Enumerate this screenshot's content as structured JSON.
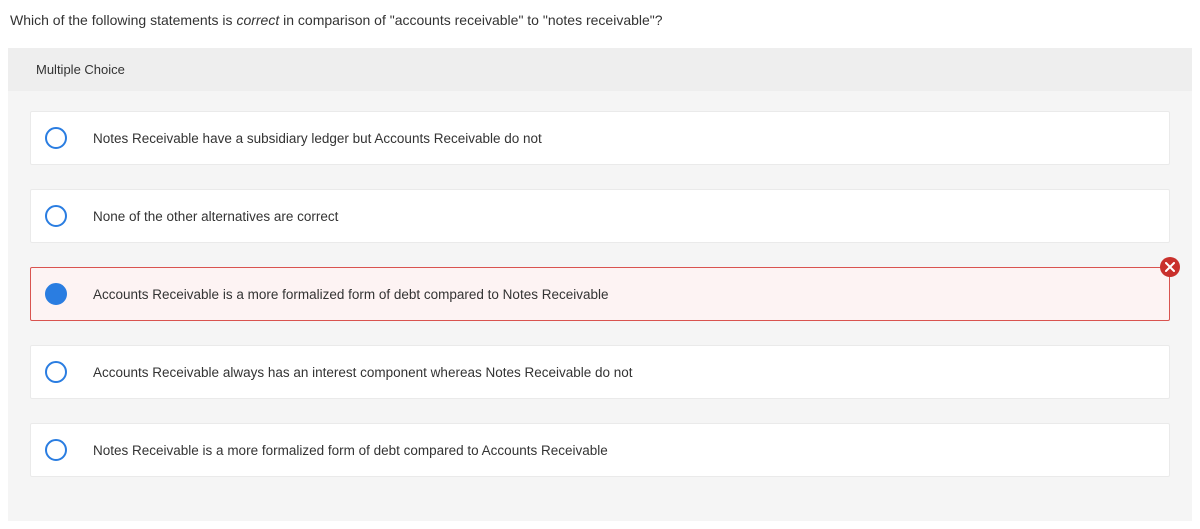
{
  "question": {
    "prefix": "Which of the following statements is ",
    "italic": "correct",
    "suffix": " in comparison of \"accounts receivable\" to \"notes receivable\"?"
  },
  "panel_label": "Multiple Choice",
  "options": [
    {
      "text": "Notes Receivable have a subsidiary ledger but Accounts Receivable do not",
      "selected": false,
      "wrong": false
    },
    {
      "text": "None of the other alternatives are correct",
      "selected": false,
      "wrong": false
    },
    {
      "text": "Accounts Receivable is a more formalized form of debt compared to Notes Receivable",
      "selected": true,
      "wrong": true
    },
    {
      "text": "Accounts Receivable always has an interest component whereas Notes Receivable do not",
      "selected": false,
      "wrong": false
    },
    {
      "text": "Notes Receivable is a more formalized form of debt compared to Accounts Receivable",
      "selected": false,
      "wrong": false
    }
  ]
}
